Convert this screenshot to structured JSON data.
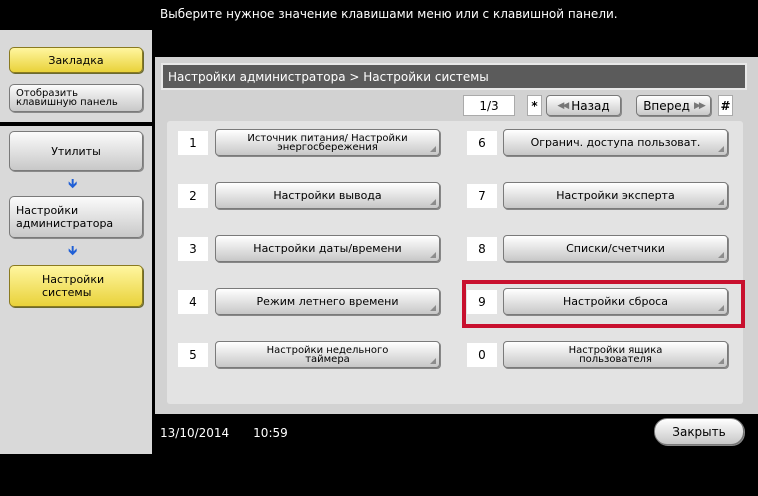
{
  "message": "Выберите нужное значение клавишами меню или с клавишной панели.",
  "sidebar": {
    "bookmark": "Закладка",
    "show_keyboard": "Отобразить клавишную панель",
    "path": [
      {
        "label": "Утилиты"
      },
      {
        "label": "Настройки администратора"
      },
      {
        "label": "Настройки системы",
        "active": true
      }
    ]
  },
  "breadcrumb": "Настройки администратора > Настройки системы",
  "pager": {
    "page": "1/3",
    "star": "*",
    "back": "Назад",
    "forward": "Вперед",
    "hash": "#"
  },
  "menu": [
    {
      "num": "1",
      "label": "Источник питания/ Настройки энергосбережения"
    },
    {
      "num": "2",
      "label": "Настройки вывода"
    },
    {
      "num": "3",
      "label": "Настройки даты/времени"
    },
    {
      "num": "4",
      "label": "Режим летнего времени"
    },
    {
      "num": "5",
      "label": "Настройки недельного таймера"
    },
    {
      "num": "6",
      "label": "Огранич. доступа пользоват."
    },
    {
      "num": "7",
      "label": "Настройки эксперта"
    },
    {
      "num": "8",
      "label": "Списки/счетчики"
    },
    {
      "num": "9",
      "label": "Настройки сброса",
      "highlighted": true
    },
    {
      "num": "0",
      "label": "Настройки ящика пользователя"
    }
  ],
  "status": {
    "date": "13/10/2014",
    "time": "10:59"
  },
  "close": "Закрыть",
  "colors": {
    "highlight": "#c8102e",
    "active": "#e9d23a",
    "arrow": "#1f5fd6"
  }
}
